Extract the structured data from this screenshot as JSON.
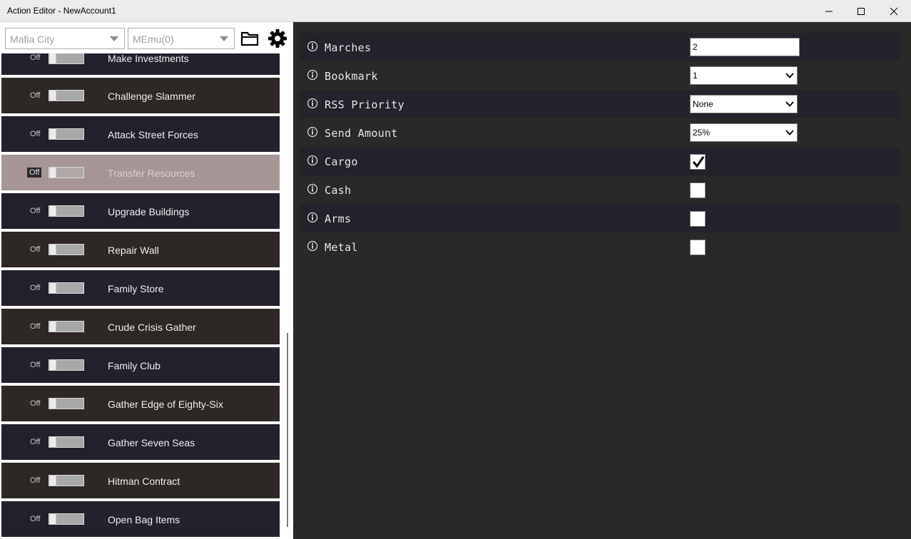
{
  "window": {
    "title": "Action Editor - NewAccount1"
  },
  "toolbar": {
    "game_select": "Mafia City",
    "emulator_select": "MEmu(0)"
  },
  "actions": [
    {
      "state": "Off",
      "label": "Make Investments"
    },
    {
      "state": "Off",
      "label": "Challenge Slammer"
    },
    {
      "state": "Off",
      "label": "Attack Street Forces"
    },
    {
      "state": "Off",
      "label": "Transfer Resources",
      "selected": true
    },
    {
      "state": "Off",
      "label": "Upgrade Buildings"
    },
    {
      "state": "Off",
      "label": "Repair Wall"
    },
    {
      "state": "Off",
      "label": "Family Store"
    },
    {
      "state": "Off",
      "label": "Crude Crisis Gather"
    },
    {
      "state": "Off",
      "label": "Family Club"
    },
    {
      "state": "Off",
      "label": "Gather Edge of Eighty-Six"
    },
    {
      "state": "Off",
      "label": "Gather Seven Seas"
    },
    {
      "state": "Off",
      "label": "Hitman Contract"
    },
    {
      "state": "Off",
      "label": "Open Bag Items"
    }
  ],
  "settings": {
    "marches": {
      "label": "Marches",
      "value": "2"
    },
    "bookmark": {
      "label": "Bookmark",
      "value": "1"
    },
    "rss_priority": {
      "label": "RSS Priority",
      "value": "None"
    },
    "send_amount": {
      "label": "Send Amount",
      "value": "25%"
    },
    "cargo": {
      "label": "Cargo",
      "checked": true
    },
    "cash": {
      "label": "Cash",
      "checked": false
    },
    "arms": {
      "label": "Arms",
      "checked": false
    },
    "metal": {
      "label": "Metal",
      "checked": false
    }
  },
  "icons": {
    "folder": "folder-icon",
    "settings": "gear-icon",
    "info": "info-icon",
    "minimize": "minimize-icon",
    "maximize": "maximize-icon",
    "close": "close-icon"
  }
}
